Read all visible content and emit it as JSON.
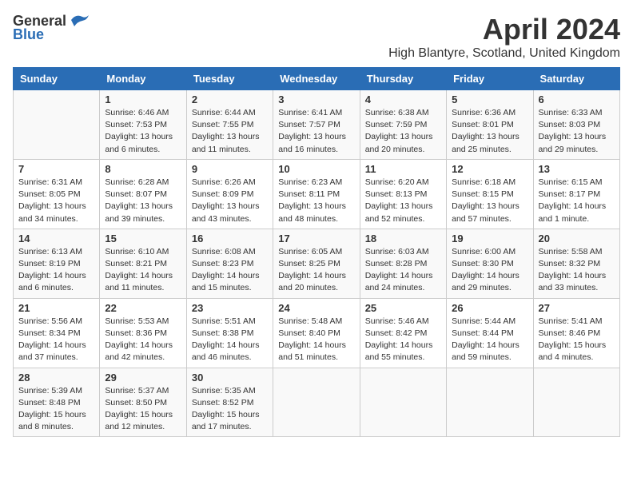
{
  "header": {
    "logo_general": "General",
    "logo_blue": "Blue",
    "month": "April 2024",
    "location": "High Blantyre, Scotland, United Kingdom"
  },
  "weekdays": [
    "Sunday",
    "Monday",
    "Tuesday",
    "Wednesday",
    "Thursday",
    "Friday",
    "Saturday"
  ],
  "weeks": [
    [
      {
        "day": "",
        "info": ""
      },
      {
        "day": "1",
        "info": "Sunrise: 6:46 AM\nSunset: 7:53 PM\nDaylight: 13 hours\nand 6 minutes."
      },
      {
        "day": "2",
        "info": "Sunrise: 6:44 AM\nSunset: 7:55 PM\nDaylight: 13 hours\nand 11 minutes."
      },
      {
        "day": "3",
        "info": "Sunrise: 6:41 AM\nSunset: 7:57 PM\nDaylight: 13 hours\nand 16 minutes."
      },
      {
        "day": "4",
        "info": "Sunrise: 6:38 AM\nSunset: 7:59 PM\nDaylight: 13 hours\nand 20 minutes."
      },
      {
        "day": "5",
        "info": "Sunrise: 6:36 AM\nSunset: 8:01 PM\nDaylight: 13 hours\nand 25 minutes."
      },
      {
        "day": "6",
        "info": "Sunrise: 6:33 AM\nSunset: 8:03 PM\nDaylight: 13 hours\nand 29 minutes."
      }
    ],
    [
      {
        "day": "7",
        "info": "Sunrise: 6:31 AM\nSunset: 8:05 PM\nDaylight: 13 hours\nand 34 minutes."
      },
      {
        "day": "8",
        "info": "Sunrise: 6:28 AM\nSunset: 8:07 PM\nDaylight: 13 hours\nand 39 minutes."
      },
      {
        "day": "9",
        "info": "Sunrise: 6:26 AM\nSunset: 8:09 PM\nDaylight: 13 hours\nand 43 minutes."
      },
      {
        "day": "10",
        "info": "Sunrise: 6:23 AM\nSunset: 8:11 PM\nDaylight: 13 hours\nand 48 minutes."
      },
      {
        "day": "11",
        "info": "Sunrise: 6:20 AM\nSunset: 8:13 PM\nDaylight: 13 hours\nand 52 minutes."
      },
      {
        "day": "12",
        "info": "Sunrise: 6:18 AM\nSunset: 8:15 PM\nDaylight: 13 hours\nand 57 minutes."
      },
      {
        "day": "13",
        "info": "Sunrise: 6:15 AM\nSunset: 8:17 PM\nDaylight: 14 hours\nand 1 minute."
      }
    ],
    [
      {
        "day": "14",
        "info": "Sunrise: 6:13 AM\nSunset: 8:19 PM\nDaylight: 14 hours\nand 6 minutes."
      },
      {
        "day": "15",
        "info": "Sunrise: 6:10 AM\nSunset: 8:21 PM\nDaylight: 14 hours\nand 11 minutes."
      },
      {
        "day": "16",
        "info": "Sunrise: 6:08 AM\nSunset: 8:23 PM\nDaylight: 14 hours\nand 15 minutes."
      },
      {
        "day": "17",
        "info": "Sunrise: 6:05 AM\nSunset: 8:25 PM\nDaylight: 14 hours\nand 20 minutes."
      },
      {
        "day": "18",
        "info": "Sunrise: 6:03 AM\nSunset: 8:28 PM\nDaylight: 14 hours\nand 24 minutes."
      },
      {
        "day": "19",
        "info": "Sunrise: 6:00 AM\nSunset: 8:30 PM\nDaylight: 14 hours\nand 29 minutes."
      },
      {
        "day": "20",
        "info": "Sunrise: 5:58 AM\nSunset: 8:32 PM\nDaylight: 14 hours\nand 33 minutes."
      }
    ],
    [
      {
        "day": "21",
        "info": "Sunrise: 5:56 AM\nSunset: 8:34 PM\nDaylight: 14 hours\nand 37 minutes."
      },
      {
        "day": "22",
        "info": "Sunrise: 5:53 AM\nSunset: 8:36 PM\nDaylight: 14 hours\nand 42 minutes."
      },
      {
        "day": "23",
        "info": "Sunrise: 5:51 AM\nSunset: 8:38 PM\nDaylight: 14 hours\nand 46 minutes."
      },
      {
        "day": "24",
        "info": "Sunrise: 5:48 AM\nSunset: 8:40 PM\nDaylight: 14 hours\nand 51 minutes."
      },
      {
        "day": "25",
        "info": "Sunrise: 5:46 AM\nSunset: 8:42 PM\nDaylight: 14 hours\nand 55 minutes."
      },
      {
        "day": "26",
        "info": "Sunrise: 5:44 AM\nSunset: 8:44 PM\nDaylight: 14 hours\nand 59 minutes."
      },
      {
        "day": "27",
        "info": "Sunrise: 5:41 AM\nSunset: 8:46 PM\nDaylight: 15 hours\nand 4 minutes."
      }
    ],
    [
      {
        "day": "28",
        "info": "Sunrise: 5:39 AM\nSunset: 8:48 PM\nDaylight: 15 hours\nand 8 minutes."
      },
      {
        "day": "29",
        "info": "Sunrise: 5:37 AM\nSunset: 8:50 PM\nDaylight: 15 hours\nand 12 minutes."
      },
      {
        "day": "30",
        "info": "Sunrise: 5:35 AM\nSunset: 8:52 PM\nDaylight: 15 hours\nand 17 minutes."
      },
      {
        "day": "",
        "info": ""
      },
      {
        "day": "",
        "info": ""
      },
      {
        "day": "",
        "info": ""
      },
      {
        "day": "",
        "info": ""
      }
    ]
  ]
}
